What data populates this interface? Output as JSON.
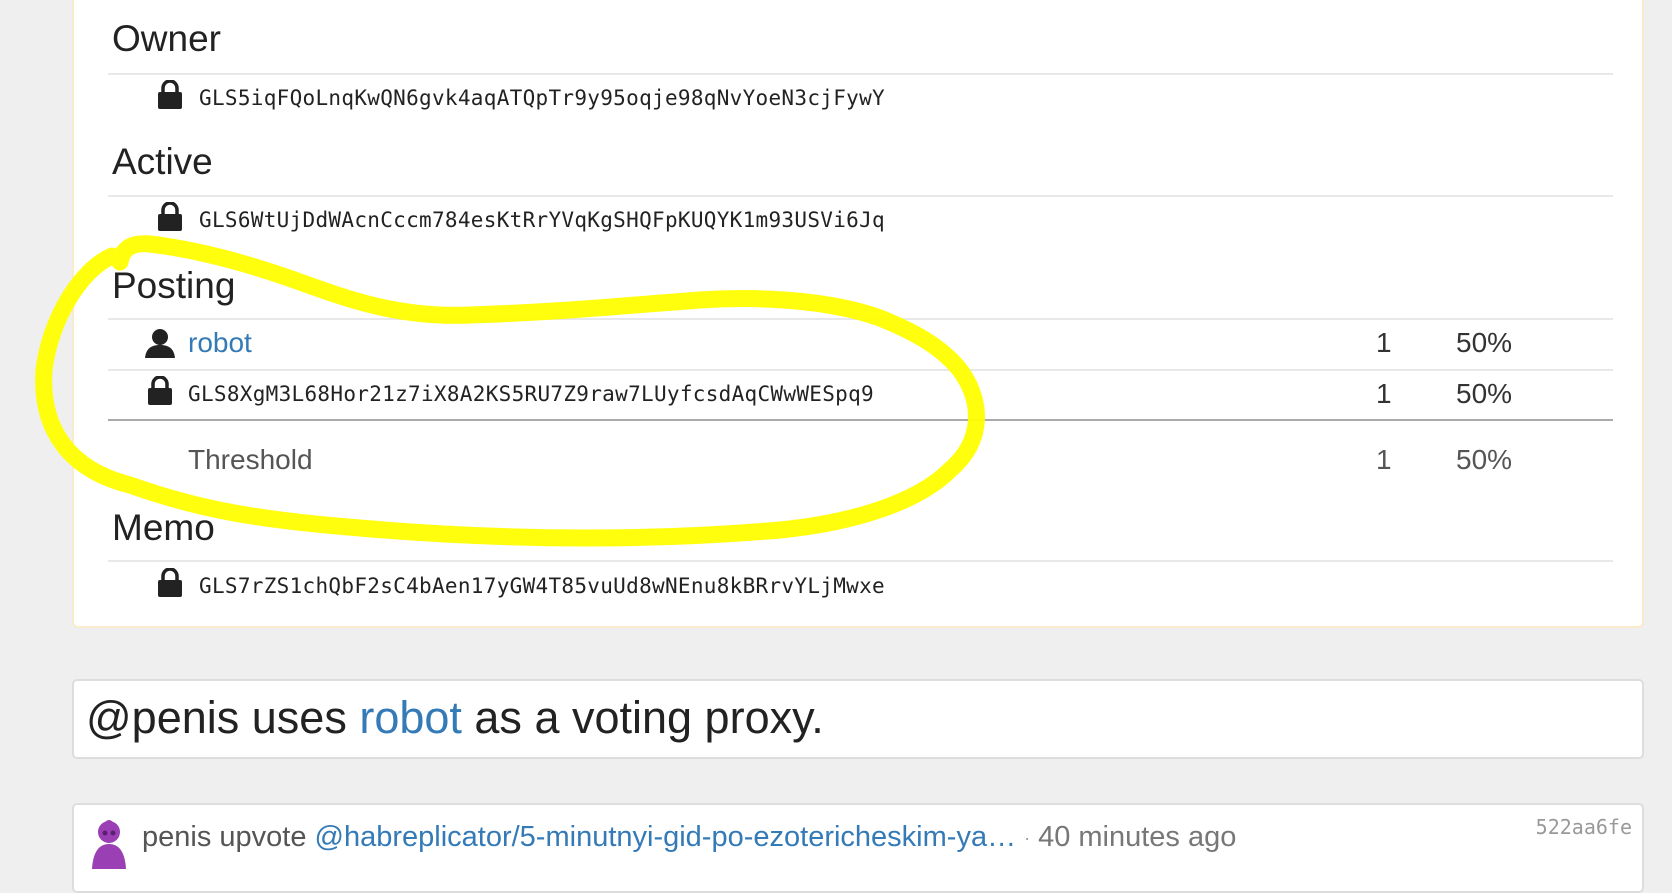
{
  "keys": {
    "owner": {
      "title": "Owner",
      "key": "GLS5iqFQoLnqKwQN6gvk4aqATQpTr9y95oqje98qNvYoeN3cjFywY"
    },
    "active": {
      "title": "Active",
      "key": "GLS6WtUjDdWAcnCccm784esKtRrYVqKgSHQFpKUQYK1m93USVi6Jq"
    },
    "posting": {
      "title": "Posting",
      "rows": [
        {
          "account": "robot",
          "weight": "1",
          "percent": "50%"
        },
        {
          "key": "GLS8XgM3L68Hor21z7iX8A2KS5RU7Z9raw7LUyfcsdAqCWwWESpq9",
          "weight": "1",
          "percent": "50%"
        }
      ],
      "threshold": {
        "label": "Threshold",
        "value": "1",
        "percent": "50%"
      }
    },
    "memo": {
      "title": "Memo",
      "key": "GLS7rZS1chQbF2sC4bAen17yGW4T85vuUd8wNEnu8kBRrvYLjMwxe"
    }
  },
  "proxy": {
    "prefix": "@penis uses ",
    "account": "robot",
    "suffix": " as a voting proxy."
  },
  "activity": {
    "user": "penis",
    "action": "upvote",
    "link": "@habreplicator/5-minutnyi-gid-po-ezotericheskim-ya…",
    "separator": "·",
    "time": "40 minutes ago",
    "hash": "522aa6fe"
  },
  "colors": {
    "link": "#337ab7",
    "highlight": "#ffff00",
    "panel_border": "#faebcc",
    "avatar": "#9b3fb5"
  }
}
